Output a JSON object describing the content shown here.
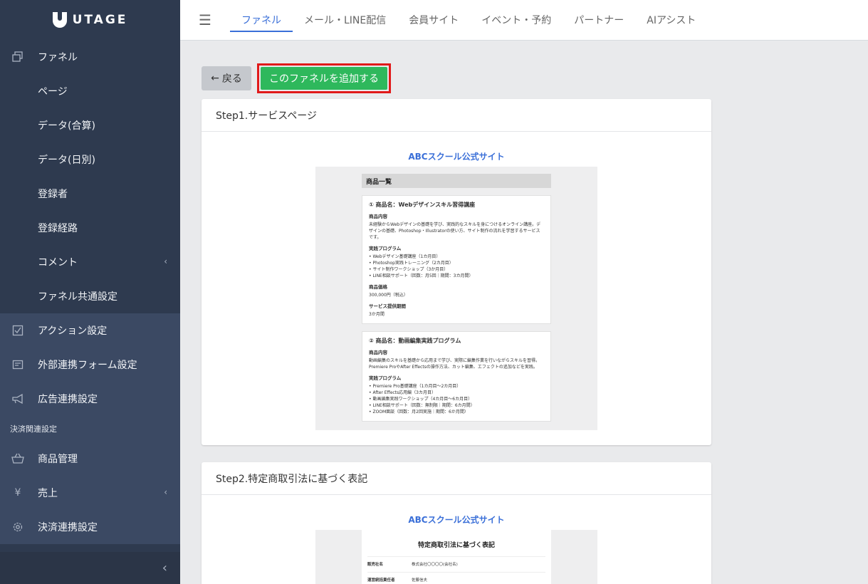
{
  "brand": {
    "name": "UTAGE"
  },
  "sidebar": {
    "top_item": {
      "label": "ファネル",
      "icon": "copy-icon"
    },
    "sub_items": [
      {
        "label": "ページ"
      },
      {
        "label": "データ(合算)"
      },
      {
        "label": "データ(日別)"
      },
      {
        "label": "登録者"
      },
      {
        "label": "登録経路"
      },
      {
        "label": "コメント",
        "chevron": "‹"
      },
      {
        "label": "ファネル共通設定"
      }
    ],
    "lower_items": [
      {
        "label": "アクション設定",
        "icon": "checkbox-icon"
      },
      {
        "label": "外部連携フォーム設定",
        "icon": "form-icon"
      },
      {
        "label": "広告連携設定",
        "icon": "megaphone-icon"
      }
    ],
    "section_label": "決済関連設定",
    "payment_items": [
      {
        "label": "商品管理",
        "icon": "basket-icon"
      },
      {
        "label": "売上",
        "icon": "yen-icon",
        "chevron": "‹"
      },
      {
        "label": "決済連携設定",
        "icon": "gear-icon"
      }
    ],
    "collapse_glyph": "‹"
  },
  "topnav": {
    "menu_glyph": "☰",
    "tabs": [
      {
        "label": "ファネル",
        "active": true
      },
      {
        "label": "メール・LINE配信"
      },
      {
        "label": "会員サイト"
      },
      {
        "label": "イベント・予約"
      },
      {
        "label": "パートナー"
      },
      {
        "label": "AIアシスト"
      }
    ]
  },
  "actions": {
    "back_label": "戻る",
    "back_arrow": "←",
    "add_label": "このファネルを追加する"
  },
  "steps": [
    {
      "title": "Step1.サービスページ",
      "site_title": "ABCスクール公式サイト",
      "preview": {
        "band": "商品一覧",
        "products": [
          {
            "heading": "① 商品名：Webデザインスキル習得講座",
            "content_label": "商品内容",
            "content": "未経験からWebデザインの基礎を学び、実践的なスキルを身につけるオンライン講座。デザインの基礎、Photoshop・Illustratorの使い方、サイト制作の流れを学習するサービスです。",
            "program_label": "実践プログラム",
            "program": [
              "Webデザイン基礎講座（1カ月目）",
              "Photoshop実践トレーニング（2カ月目）",
              "サイト制作ワークショップ（3か月目）",
              "LINE相談サポート（回数：月5回｜期間：3カ月間）"
            ],
            "price_label": "商品価格",
            "price": "300,000円（税込）",
            "period_label": "サービス提供期間",
            "period": "3か月間"
          },
          {
            "heading": "② 商品名：動画編集実践プログラム",
            "content_label": "商品内容",
            "content": "動画編集のスキルを基礎から応用まで学び、実際に編集作業を行いながらスキルを習得。Premiere ProやAfter Effectsの操作方法、カット編集、エフェクトの追加などを実践。",
            "program_label": "実践プログラム",
            "program": [
              "Premiere Pro基礎講座（1カ月目〜2カ月目）",
              "After Effects応用編（3カ月目）",
              "動画編集実践ワークショップ（4カ月目〜6カ月目）",
              "LINE相談サポート（回数：無制限｜期間：6カ月間）",
              "ZOOM面談（回数：月2回実施｜期間：6か月間）"
            ]
          }
        ]
      }
    },
    {
      "title": "Step2.特定商取引法に基づく表記",
      "site_title": "ABCスクール公式サイト",
      "preview": {
        "heading": "特定商取引法に基づく表記",
        "rows": [
          {
            "key": "販売社名",
            "value": "株式会社〇〇〇〇(会社名)"
          },
          {
            "key": "運営統括責任者",
            "value": "佐藤信夫"
          }
        ]
      }
    }
  ],
  "colors": {
    "sidebar_bg": "#2e3a4f",
    "sidebar_lower_bg": "#3b4963",
    "accent": "#3a6fd8",
    "add_button": "#2eb85c",
    "highlight": "#e11a1a"
  }
}
